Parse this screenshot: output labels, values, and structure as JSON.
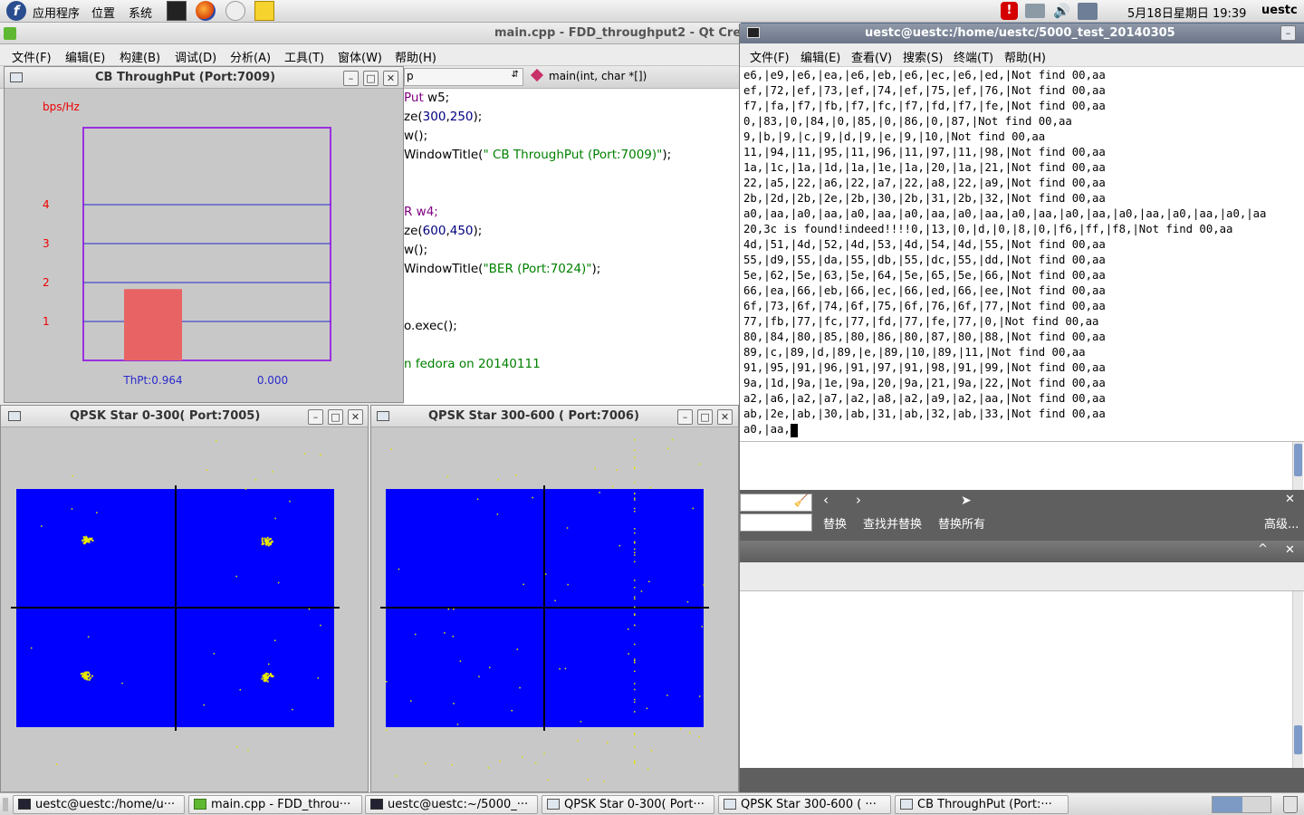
{
  "top_panel": {
    "menus": [
      "应用程序",
      "位置",
      "系统"
    ],
    "datetime": "5月18日星期日 19:39",
    "user": "uestc"
  },
  "qt": {
    "title": "main.cpp - FDD_throughput2 - Qt Cre",
    "menus": [
      "文件(F)",
      "编辑(E)",
      "构建(B)",
      "调试(D)",
      "分析(A)",
      "工具(T)",
      "窗体(W)",
      "帮助(H)"
    ],
    "file_combo": "p",
    "func_combo": "main(int, char *[])",
    "code_lines": [
      "Put w5;",
      "ze(300,250);",
      "w();",
      "WindowTitle(\" CB ThroughPut (Port:7009)\");",
      "",
      "",
      "R w4;",
      "ze(600,450);",
      "w();",
      "WindowTitle(\"BER (Port:7024)\");",
      "",
      "",
      "o.exec();",
      "",
      "n fedora on 20140111"
    ]
  },
  "cb": {
    "title": "CB ThroughPut (Port:7009)",
    "unit_label": "bps/Hz",
    "thpt_label": "ThPt:0.964",
    "right_label": "0.000"
  },
  "chart_data": {
    "type": "bar",
    "categories": [
      "ThPt:0.964",
      "0.000"
    ],
    "values": [
      0.964,
      0.0
    ],
    "ylabel": "bps/Hz",
    "yticks": [
      1,
      2,
      3,
      4
    ],
    "ylim": [
      0,
      6
    ],
    "grid": true,
    "bar_color": "#e86464",
    "frame_color": "#9a30e0"
  },
  "star1": {
    "title": "QPSK Star 0-300( Port:7005)"
  },
  "star2": {
    "title": "QPSK Star 300-600 ( Port:7006)"
  },
  "term": {
    "title": "uestc@uestc:/home/uestc/5000_test_20140305",
    "menus": [
      "文件(F)",
      "编辑(E)",
      "查看(V)",
      "搜索(S)",
      "终端(T)",
      "帮助(H)"
    ],
    "lines": [
      "e6,|e9,|e6,|ea,|e6,|eb,|e6,|ec,|e6,|ed,|Not find 00,aa",
      "ef,|72,|ef,|73,|ef,|74,|ef,|75,|ef,|76,|Not find 00,aa",
      "f7,|fa,|f7,|fb,|f7,|fc,|f7,|fd,|f7,|fe,|Not find 00,aa",
      "0,|83,|0,|84,|0,|85,|0,|86,|0,|87,|Not find 00,aa",
      "9,|b,|9,|c,|9,|d,|9,|e,|9,|10,|Not find 00,aa",
      "11,|94,|11,|95,|11,|96,|11,|97,|11,|98,|Not find 00,aa",
      "1a,|1c,|1a,|1d,|1a,|1e,|1a,|20,|1a,|21,|Not find 00,aa",
      "22,|a5,|22,|a6,|22,|a7,|22,|a8,|22,|a9,|Not find 00,aa",
      "2b,|2d,|2b,|2e,|2b,|30,|2b,|31,|2b,|32,|Not find 00,aa",
      "a0,|aa,|a0,|aa,|a0,|aa,|a0,|aa,|a0,|aa,|a0,|aa,|a0,|aa,|a0,|aa,|a0,|aa,|a0,|aa",
      "20,3c is found!indeed!!!!0,|13,|0,|d,|0,|8,|0,|f6,|ff,|f8,|Not find 00,aa",
      "4d,|51,|4d,|52,|4d,|53,|4d,|54,|4d,|55,|Not find 00,aa",
      "55,|d9,|55,|da,|55,|db,|55,|dc,|55,|dd,|Not find 00,aa",
      "5e,|62,|5e,|63,|5e,|64,|5e,|65,|5e,|66,|Not find 00,aa",
      "66,|ea,|66,|eb,|66,|ec,|66,|ed,|66,|ee,|Not find 00,aa",
      "6f,|73,|6f,|74,|6f,|75,|6f,|76,|6f,|77,|Not find 00,aa",
      "77,|fb,|77,|fc,|77,|fd,|77,|fe,|77,|0,|Not find 00,aa",
      "80,|84,|80,|85,|80,|86,|80,|87,|80,|88,|Not find 00,aa",
      "89,|c,|89,|d,|89,|e,|89,|10,|89,|11,|Not find 00,aa",
      "91,|95,|91,|96,|91,|97,|91,|98,|91,|99,|Not find 00,aa",
      "9a,|1d,|9a,|1e,|9a,|20,|9a,|21,|9a,|22,|Not find 00,aa",
      "a2,|a6,|a2,|a7,|a2,|a8,|a2,|a9,|a2,|aa,|Not find 00,aa",
      "ab,|2e,|ab,|30,|ab,|31,|ab,|32,|ab,|33,|Not find 00,aa",
      "a0,|aa,"
    ]
  },
  "find_bar": {
    "replace": "替换",
    "find_replace": "查找并替换",
    "replace_all": "替换所有",
    "advanced": "高级..."
  },
  "taskbar": {
    "items": [
      "uestc@uestc:/home/u···",
      "main.cpp - FDD_throu···",
      "uestc@uestc:~/5000_···",
      "QPSK Star 0-300( Port···",
      "QPSK Star 300-600 ( ···",
      "CB ThroughPut (Port:···"
    ]
  }
}
